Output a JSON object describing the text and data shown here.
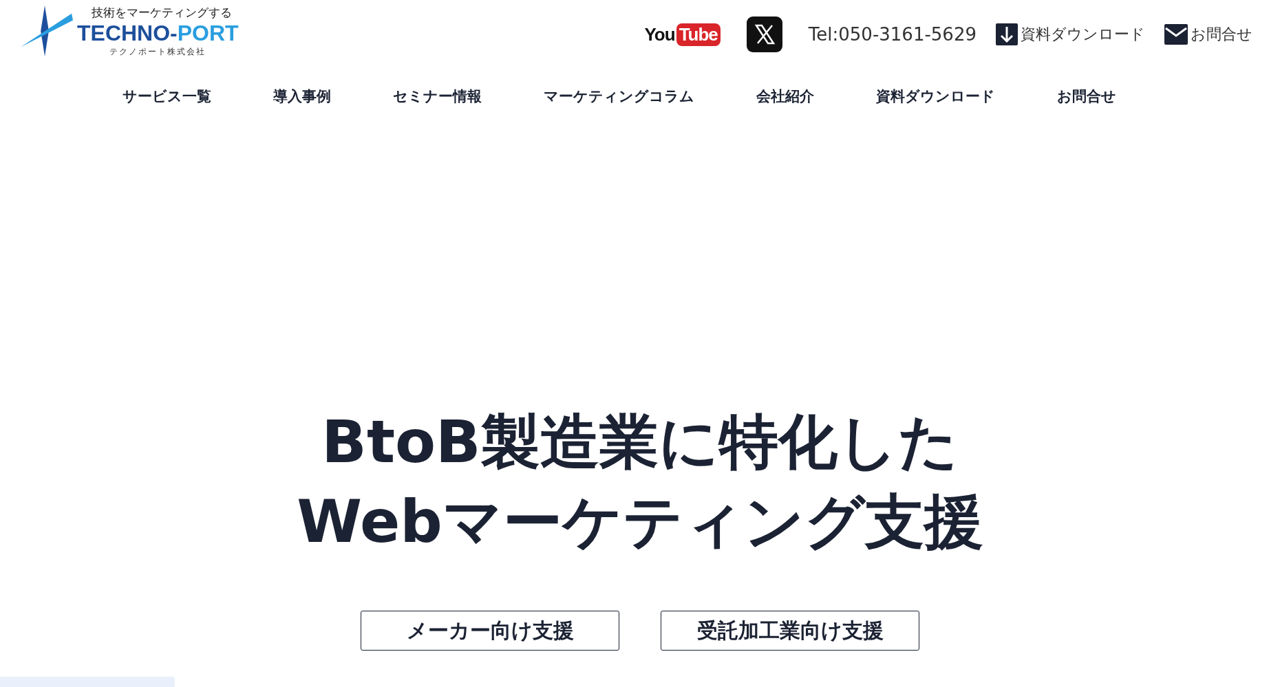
{
  "logo": {
    "tagline": "技術をマーケティングする",
    "name_dark": "TECHNO-",
    "name_light": "PORT",
    "company": "テクノポート株式会社"
  },
  "header": {
    "youtube": {
      "you": "You",
      "tube": "Tube"
    },
    "tel": "Tel:050-3161-5629",
    "download": "資料ダウンロード",
    "contact": "お問合せ"
  },
  "nav": [
    "サービス一覧",
    "導入事例",
    "セミナー情報",
    "マーケティングコラム",
    "会社紹介",
    "資料ダウンロード",
    "お問合せ"
  ],
  "hero": {
    "lines": [
      "BtoB製造業に特化した",
      "Webマーケティング支援"
    ],
    "buttons": [
      "メーカー向け支援",
      "受託加工業向け支援"
    ]
  }
}
